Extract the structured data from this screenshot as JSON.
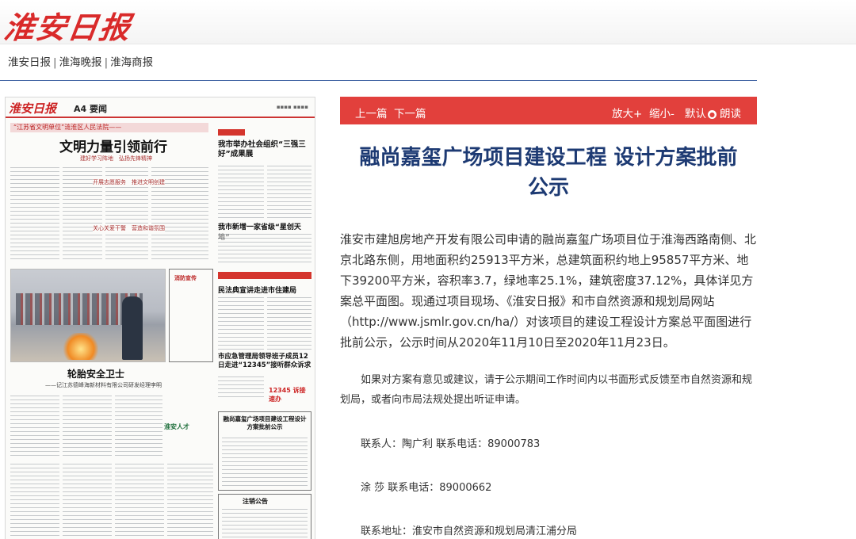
{
  "masthead": {
    "logo_text": "淮安日报"
  },
  "nav": {
    "items": [
      "淮安日报",
      "淮海晚报",
      "淮海商报"
    ]
  },
  "paper": {
    "logo": "淮安日报",
    "section": "A4 要闻",
    "kicker": "“江苏省文明单位”涟淮区人民法院——",
    "headline": "文明力量引领前行",
    "sub1": "建好学习阵地　弘扬先锋精神",
    "sub2": "开展志愿服务　推进文明创建",
    "sub3": "关心关爱干警　营造和谐氛围",
    "r_head1": "我市举办社会组织“三强三好”成果展",
    "r_head2": "我市新增一家省级“星创天地”",
    "photo_caption": "轮胎安全卫士",
    "photo_sub": "——记江苏德峰海新材料有限公司研发经理李明",
    "fire_label": "消防宣传",
    "r_head3": "民法典宣讲走进市住建局",
    "r_head4": "市应急管理局领导班子成员12日走进“12345”接听群众诉求",
    "hotline": "12345 诉接速办",
    "notice_title": "融尚嘉玺广场项目建设工程设计方案批前公示",
    "cancel_title": "注销公告",
    "talent": "淮安人才"
  },
  "toolbar": {
    "prev": "上一篇",
    "next": "下一篇",
    "zoom_in": "放大+",
    "zoom_out": "缩小-",
    "default": "默认",
    "read": "朗读"
  },
  "article": {
    "title_line1": "融尚嘉玺广场项目建设工程 设计方案批前",
    "title_line2": "公示",
    "para1": "淮安市建旭房地产开发有限公司申请的融尚嘉玺广场项目位于淮海西路南侧、北京北路东侧，用地面积约25913平方米，总建筑面积约地上95857平方米、地下39200平方米，容积率3.7，绿地率25.1%，建筑密度37.12%，具体详见方案总平面图。现通过项目现场、《淮安日报》和市自然资源和规划局网站（http://www.jsmlr.gov.cn/ha/）对该项目的建设工程设计方案总平面图进行批前公示，公示时间从2020年11月10日至2020年11月23日。",
    "para2": "如果对方案有意见或建议，请于公示期间工作时间内以书面形式反馈至市自然资源和规划局，或者向市局法规处提出听证申请。",
    "contact1": "联系人：陶广利  联系电话：89000783",
    "contact2": "涂  莎  联系电话：89000662",
    "address": "联系地址：淮安市自然资源和规划局清江浦分局"
  }
}
